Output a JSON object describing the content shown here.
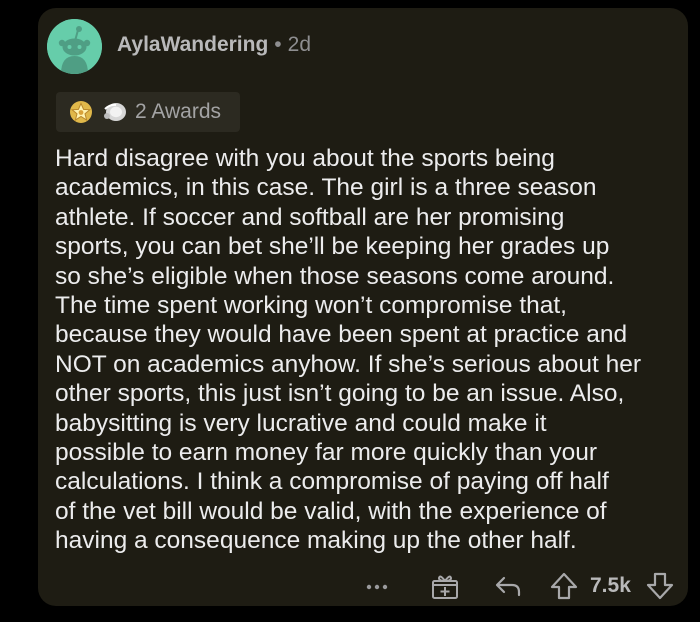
{
  "comment": {
    "username": "AylaWandering",
    "separator": "•",
    "age": "2d",
    "awards_label": "2 Awards",
    "body": "Hard disagree with you about the sports being\nacademics, in this case. The girl is a three season\nathlete. If soccer and softball are her promising\nsports, you can bet she’ll be keeping her grades up\nso she’s eligible when those seasons come around.\nThe time spent working won’t compromise that,\nbecause they would have been spent at practice and\nNOT on academics anyhow. If she’s serious about her\nother sports, this just isn’t going to be an issue. Also,\nbabysitting is very lucrative and could make it\npossible to earn money far more quickly than your\ncalculations. I think a compromise of paying off half\nof the vet bill would be valid, with the experience of\nhaving a consequence making up the other half.",
    "vote_count": "7.5k"
  },
  "icons": {
    "more": "more-options-icon",
    "award": "gift-award-icon",
    "reply": "reply-icon",
    "upvote": "upvote-arrow-icon",
    "downvote": "downvote-arrow-icon"
  },
  "colors": {
    "card_background": "#1e1c13",
    "avatar": "#66cdaa",
    "text": "#ececed",
    "muted": "#8e8e90"
  }
}
